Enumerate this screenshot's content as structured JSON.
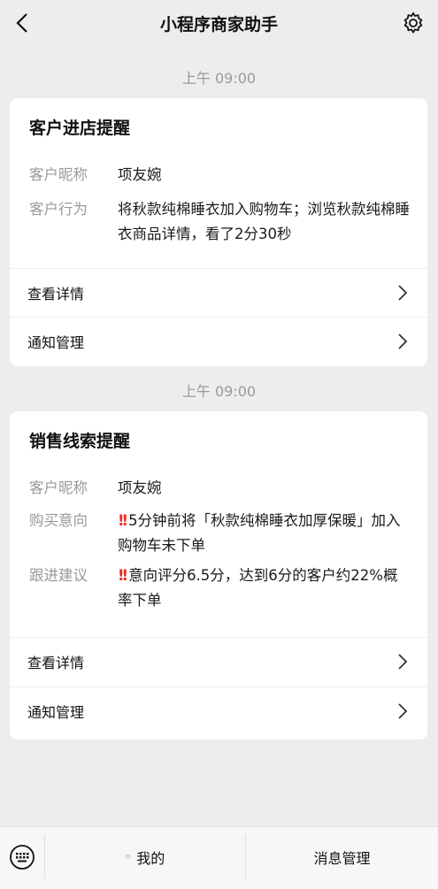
{
  "nav": {
    "title": "小程序商家助手"
  },
  "messages": [
    {
      "time": "上午 09:00",
      "title": "客户进店提醒",
      "fields": [
        {
          "key": "客户昵称",
          "value": "项友婉"
        },
        {
          "key": "客户行为",
          "value": "将秋款纯棉睡衣加入购物车；浏览秋款纯棉睡衣商品详情，看了2分30秒"
        }
      ],
      "links": [
        "查看详情",
        "通知管理"
      ]
    },
    {
      "time": "上午 09:00",
      "title": "销售线索提醒",
      "fields": [
        {
          "key": "客户昵称",
          "value": "项友婉"
        },
        {
          "key": "购买意向",
          "alert": "!!",
          "value": "5分钟前将「秋款纯棉睡衣加厚保暖」加入购物车未下单"
        },
        {
          "key": "跟进建议",
          "alert": "!!",
          "value": "意向评分6.5分，达到6分的客户约22%概率下单"
        }
      ],
      "links": [
        "查看详情",
        "通知管理"
      ]
    }
  ],
  "bottom_bar": {
    "tab1": "我的",
    "tab2": "消息管理"
  },
  "colors": {
    "background": "#ededed",
    "alert": "#e52b1f",
    "muted": "#9a9a9a"
  }
}
